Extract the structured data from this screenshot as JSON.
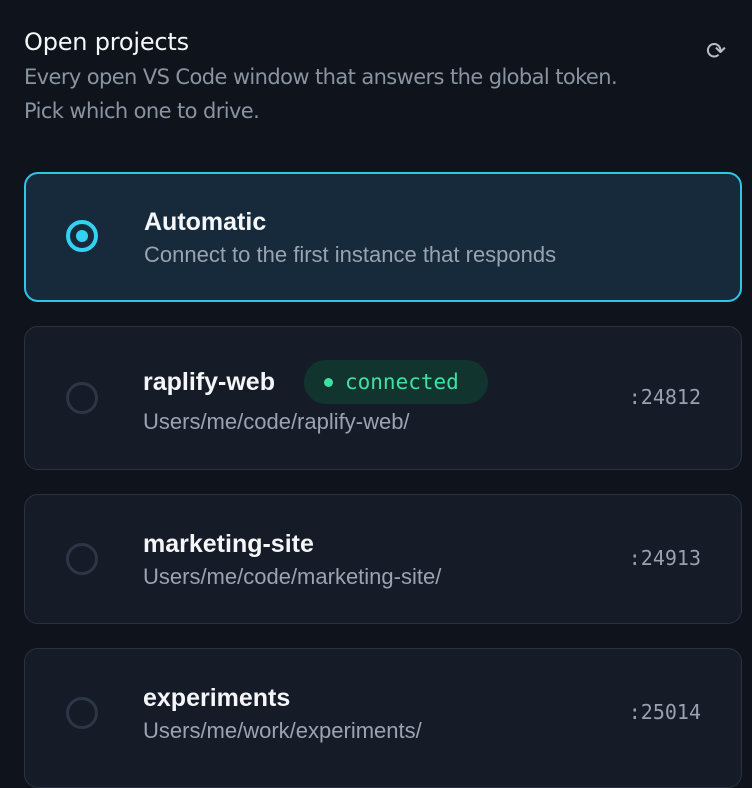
{
  "header": {
    "title": "Open projects",
    "subtitle": "Every open VS Code window that answers the global token. Pick which one to drive.",
    "refresh_icon": "refresh-icon"
  },
  "options": [
    {
      "name": "Automatic",
      "description": "Connect to the first instance that responds",
      "selected": true
    },
    {
      "name": "raplify-web",
      "path": "Users/me/code/raplify-web/",
      "port": ":24812",
      "badge": "connected",
      "selected": false
    },
    {
      "name": "marketing-site",
      "path": "Users/me/code/marketing-site/",
      "port": ":24913",
      "selected": false
    },
    {
      "name": "experiments",
      "path": "Users/me/work/experiments/",
      "port": ":25014",
      "selected": false
    }
  ],
  "colors": {
    "background": "#0f141c",
    "card": "#151c28",
    "accent": "#33d2f2",
    "connected": "#3ee0a4"
  }
}
